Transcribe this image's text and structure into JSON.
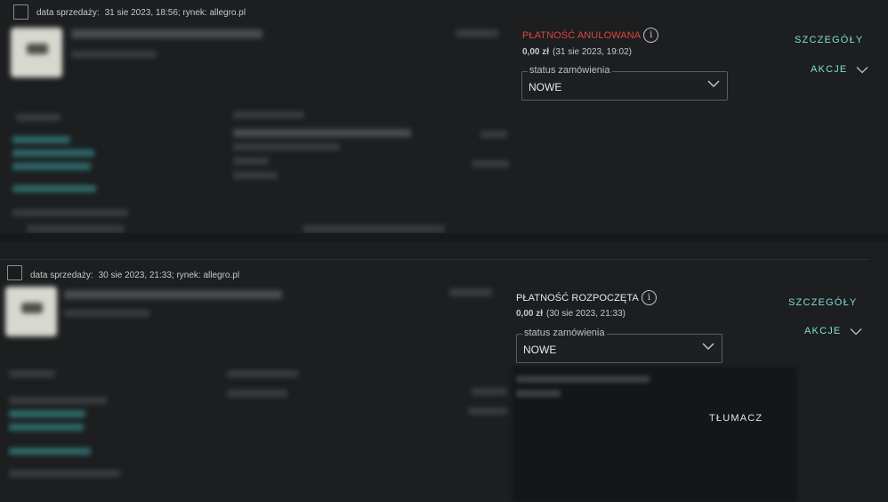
{
  "orders": [
    {
      "sale_label": "data sprzedaży:",
      "sale_info": "31 sie 2023, 18:56; rynek: allegro.pl",
      "payment_status": "PŁATNOŚĆ ANULOWANA",
      "payment_status_color": "#e0453f",
      "amount": "0,00 zł",
      "payment_date": "(31 sie 2023, 19:02)",
      "status_legend": "status zamówienia",
      "status_value": "NOWE",
      "details_label": "SZCZEGÓŁY",
      "actions_label": "AKCJE"
    },
    {
      "sale_label": "data sprzedaży:",
      "sale_info": "30 sie 2023, 21:33; rynek: allegro.pl",
      "payment_status": "PŁATNOŚĆ ROZPOCZĘTA",
      "payment_status_color": "#e6e8ea",
      "amount": "0,00 zł",
      "payment_date": "(30 sie 2023, 21:33)",
      "status_legend": "status zamówienia",
      "status_value": "NOWE",
      "details_label": "SZCZEGÓŁY",
      "actions_label": "AKCJE",
      "translate_label": "TŁUMACZ"
    }
  ],
  "icons": {
    "info": "info-icon",
    "chevron": "chevron-down-icon"
  },
  "colors": {
    "accent": "#7fe0d6",
    "background": "#1c1e20"
  }
}
